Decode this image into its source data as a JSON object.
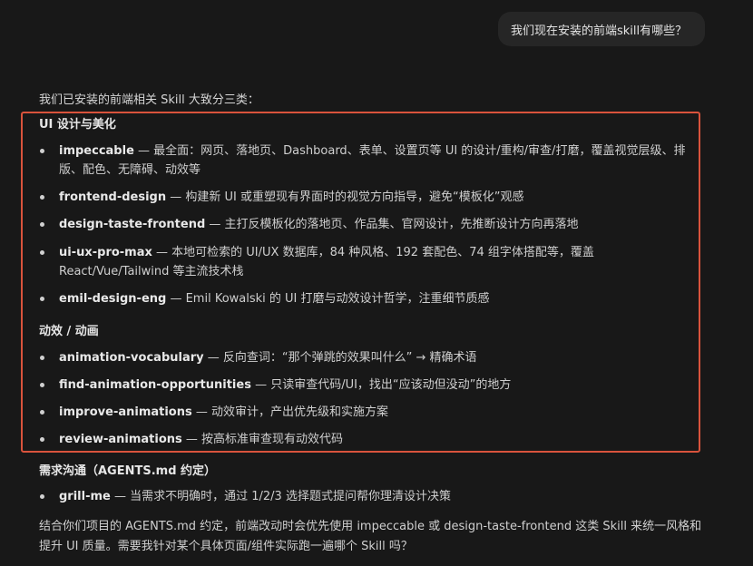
{
  "user_message": "我们现在安装的前端skill有哪些？",
  "intro": "我们已安装的前端相关 Skill 大致分三类：",
  "groups": [
    {
      "title": "UI 设计与美化",
      "items": [
        {
          "name": "impeccable",
          "desc": " — 最全面：网页、落地页、Dashboard、表单、设置页等 UI 的设计/重构/审查/打磨，覆盖视觉层级、排版、配色、无障碍、动效等"
        },
        {
          "name": "frontend-design",
          "desc": " — 构建新 UI 或重塑现有界面时的视觉方向指导，避免“模板化”观感"
        },
        {
          "name": "design-taste-frontend",
          "desc": " — 主打反模板化的落地页、作品集、官网设计，先推断设计方向再落地"
        },
        {
          "name": "ui-ux-pro-max",
          "desc": " — 本地可检索的 UI/UX 数据库，84 种风格、192 套配色、74 组字体搭配等，覆盖 React/Vue/Tailwind 等主流技术栈"
        },
        {
          "name": "emil-design-eng",
          "desc": " — Emil Kowalski 的 UI 打磨与动效设计哲学，注重细节质感"
        }
      ]
    },
    {
      "title": "动效 / 动画",
      "items": [
        {
          "name": "animation-vocabulary",
          "desc": " — 反向查词：“那个弹跳的效果叫什么” → 精确术语"
        },
        {
          "name": "find-animation-opportunities",
          "desc": " — 只读审查代码/UI，找出“应该动但没动”的地方"
        },
        {
          "name": "improve-animations",
          "desc": " — 动效审计，产出优先级和实施方案"
        },
        {
          "name": "review-animations",
          "desc": " — 按高标准审查现有动效代码"
        }
      ]
    },
    {
      "title": "需求沟通（AGENTS.md 约定）",
      "items": [
        {
          "name": "grill-me",
          "desc": " — 当需求不明确时，通过 1/2/3 选择题式提问帮你理清设计决策"
        }
      ]
    }
  ],
  "outro": "结合你们项目的 AGENTS.md 约定，前端改动时会优先使用 impeccable 或 design-taste-frontend 这类 Skill 来统一风格和提升 UI 质量。需要我针对某个具体页面/组件实际跑一遍哪个 Skill 吗？",
  "colors": {
    "background": "#181818",
    "bubble": "#262626",
    "highlight_border": "#d9533c"
  }
}
